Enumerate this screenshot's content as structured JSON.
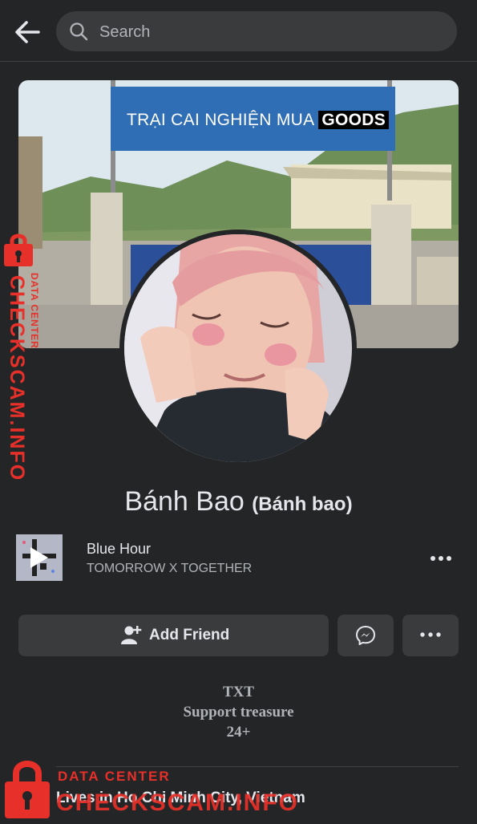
{
  "header": {
    "search_placeholder": "Search"
  },
  "cover": {
    "sign_text": "TRẠI CAI NGHIỆN MUA",
    "sign_highlight": "GOODS"
  },
  "profile": {
    "name": "Bánh Bao",
    "alternate_name": "(Bánh bao)"
  },
  "music": {
    "song": "Blue Hour",
    "artist": "TOMORROW X TOGETHER"
  },
  "actions": {
    "add_friend": "Add Friend"
  },
  "bio": {
    "line1": "TXT",
    "line2": "Support treasure",
    "line3": "24+"
  },
  "details": {
    "lives_in": "Lives in Ho Chi Minh City, Vietnam"
  },
  "watermark": {
    "data_center": "DATA CENTER",
    "site": "CHECKSCAM.INFO"
  },
  "colors": {
    "background": "#242526",
    "button": "#3a3b3c",
    "watermark": "#e8302a"
  }
}
